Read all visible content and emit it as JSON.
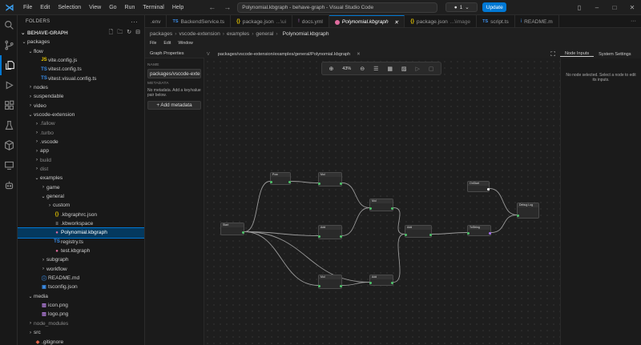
{
  "titlebar": {
    "menu": [
      "File",
      "Edit",
      "Selection",
      "View",
      "Go",
      "Run",
      "Terminal",
      "Help"
    ],
    "command_center": "Polynomial.kbgraph - behave-graph - Visual Studio Code",
    "copilot_count": "1",
    "update_label": "Update"
  },
  "sidebar": {
    "header": "FOLDERS",
    "root": "BEHAVE-GRAPH",
    "items": [
      {
        "label": "packages",
        "depth": 0,
        "kind": "folder-open"
      },
      {
        "label": "flow",
        "depth": 1,
        "kind": "folder-open"
      },
      {
        "label": "vite.config.js",
        "depth": 2,
        "kind": "js"
      },
      {
        "label": "vitest.config.ts",
        "depth": 2,
        "kind": "ts"
      },
      {
        "label": "vitest.visual.config.ts",
        "depth": 2,
        "kind": "ts"
      },
      {
        "label": "nodes",
        "depth": 1,
        "kind": "folder"
      },
      {
        "label": "suspendable",
        "depth": 1,
        "kind": "folder"
      },
      {
        "label": "video",
        "depth": 1,
        "kind": "folder"
      },
      {
        "label": "vscode-extension",
        "depth": 1,
        "kind": "folder-open"
      },
      {
        "label": ".fallow",
        "depth": 2,
        "kind": "folder-dim"
      },
      {
        "label": ".turbo",
        "depth": 2,
        "kind": "folder-dim"
      },
      {
        "label": ".vscode",
        "depth": 2,
        "kind": "folder"
      },
      {
        "label": "app",
        "depth": 2,
        "kind": "folder"
      },
      {
        "label": "build",
        "depth": 2,
        "kind": "folder-dim"
      },
      {
        "label": "dist",
        "depth": 2,
        "kind": "folder-dim"
      },
      {
        "label": "examples",
        "depth": 2,
        "kind": "folder-open"
      },
      {
        "label": "game",
        "depth": 3,
        "kind": "folder"
      },
      {
        "label": "general",
        "depth": 3,
        "kind": "folder-open"
      },
      {
        "label": "custom",
        "depth": 4,
        "kind": "folder"
      },
      {
        "label": ".kbgraphrc.json",
        "depth": 4,
        "kind": "json"
      },
      {
        "label": ".kbworkspace",
        "depth": 4,
        "kind": "txt"
      },
      {
        "label": "Polynomial.kbgraph",
        "depth": 4,
        "kind": "kbg",
        "selected": true
      },
      {
        "label": "registry.ts",
        "depth": 4,
        "kind": "ts"
      },
      {
        "label": "test.kbgraph",
        "depth": 4,
        "kind": "kbg"
      },
      {
        "label": "subgraph",
        "depth": 3,
        "kind": "folder"
      },
      {
        "label": "workflow",
        "depth": 3,
        "kind": "folder"
      },
      {
        "label": "README.md",
        "depth": 2,
        "kind": "info"
      },
      {
        "label": "tsconfig.json",
        "depth": 2,
        "kind": "tsconfig"
      },
      {
        "label": "media",
        "depth": 1,
        "kind": "folder-open"
      },
      {
        "label": "icon.png",
        "depth": 2,
        "kind": "img"
      },
      {
        "label": "logo.png",
        "depth": 2,
        "kind": "img"
      },
      {
        "label": "node_modules",
        "depth": 1,
        "kind": "folder-dim"
      },
      {
        "label": "src",
        "depth": 1,
        "kind": "folder"
      },
      {
        "label": ".gitignore",
        "depth": 1,
        "kind": "git"
      }
    ]
  },
  "tabs": [
    {
      "label": ".env",
      "icon": "",
      "active": false
    },
    {
      "label": "BackendService.ts",
      "icon": "TS",
      "active": false
    },
    {
      "label": "package.json",
      "suffix": "...\\ui",
      "icon": "{}",
      "active": false
    },
    {
      "label": "docs.yml",
      "icon": "!",
      "active": false
    },
    {
      "label": "Polynomial.kbgraph",
      "icon": "kbg",
      "active": true
    },
    {
      "label": "package.json",
      "suffix": "...\\image",
      "icon": "{}",
      "active": false
    },
    {
      "label": "script.ts",
      "icon": "TS",
      "active": false
    },
    {
      "label": "README.m",
      "icon": "i",
      "active": false
    }
  ],
  "breadcrumb": [
    "packages",
    "vscode-extension",
    "examples",
    "general",
    "Polynomial.kbgraph"
  ],
  "kb_menu": [
    "File",
    "Edit",
    "Window"
  ],
  "graph_properties": {
    "title": "Graph Properties",
    "name_label": "NAME",
    "name_value": "packages/vscode-exten",
    "metadata_label": "METADATA",
    "metadata_empty": "No metadata. Add a key/value pair below.",
    "add_button": "+ Add metadata"
  },
  "canvas": {
    "path": "packages/vscode-extension/examples/general/Polynomial.kbgraph",
    "zoom": "43%"
  },
  "node_inputs": {
    "tab_active": "Node Inputs",
    "tab_other": "System Settings",
    "empty": "No node selected. Select a node to edit its inputs."
  },
  "graph_nodes": [
    {
      "id": "n1",
      "title": "Start"
    },
    {
      "id": "n2",
      "title": "Pow"
    },
    {
      "id": "n3",
      "title": "Mul"
    },
    {
      "id": "n4",
      "title": "Mul"
    },
    {
      "id": "n5",
      "title": "Add"
    },
    {
      "id": "n6",
      "title": "Add"
    },
    {
      "id": "n7",
      "title": "Mul"
    },
    {
      "id": "n8",
      "title": "Add"
    },
    {
      "id": "n9",
      "title": "ToString"
    },
    {
      "id": "n10",
      "title": "OnStart"
    },
    {
      "id": "n11",
      "title": "Debug Log"
    }
  ],
  "colors": {
    "accent": "#0078d4",
    "selection": "#04395e",
    "exec_port": "#ffffff",
    "data_port": "#4ec36a",
    "string_port": "#a970ff"
  }
}
